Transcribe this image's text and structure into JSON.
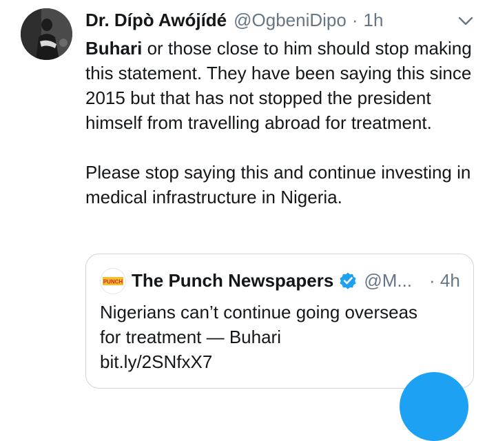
{
  "tweet": {
    "author_name": "Dr. Dípò Awójídé",
    "handle": "@OgbeniDipo",
    "separator": "·",
    "time": "1h",
    "avatar_icon": "person-photo",
    "menu_icon": "chevron-down-icon",
    "mention": "Buhari",
    "paragraph1_rest": " or those close to him should stop making this statement. They have been saying this since 2015 but that has not stopped the president himself from travelling abroad for treatment.",
    "paragraph2": "Please stop saying this and continue investing in medical infrastructure in Nigeria."
  },
  "quoted_tweet": {
    "author_name": "The Punch Newspapers",
    "avatar_text": "PUNCH",
    "verified_icon": "verified-badge-icon",
    "handle": "@M...",
    "time_display": "· 4h",
    "text_line1": "Nigerians can’t continue going overseas",
    "text_line2": "for treatment — Buhari",
    "link": "bit.ly/2SNfxX7"
  },
  "compose_button_icon": "compose-fab",
  "colors": {
    "text_primary": "#14171a",
    "text_secondary": "#657786",
    "border": "#ccd6dd",
    "accent": "#1da1f2",
    "punch_red": "#d7262b",
    "punch_gold": "#f2c12e"
  }
}
